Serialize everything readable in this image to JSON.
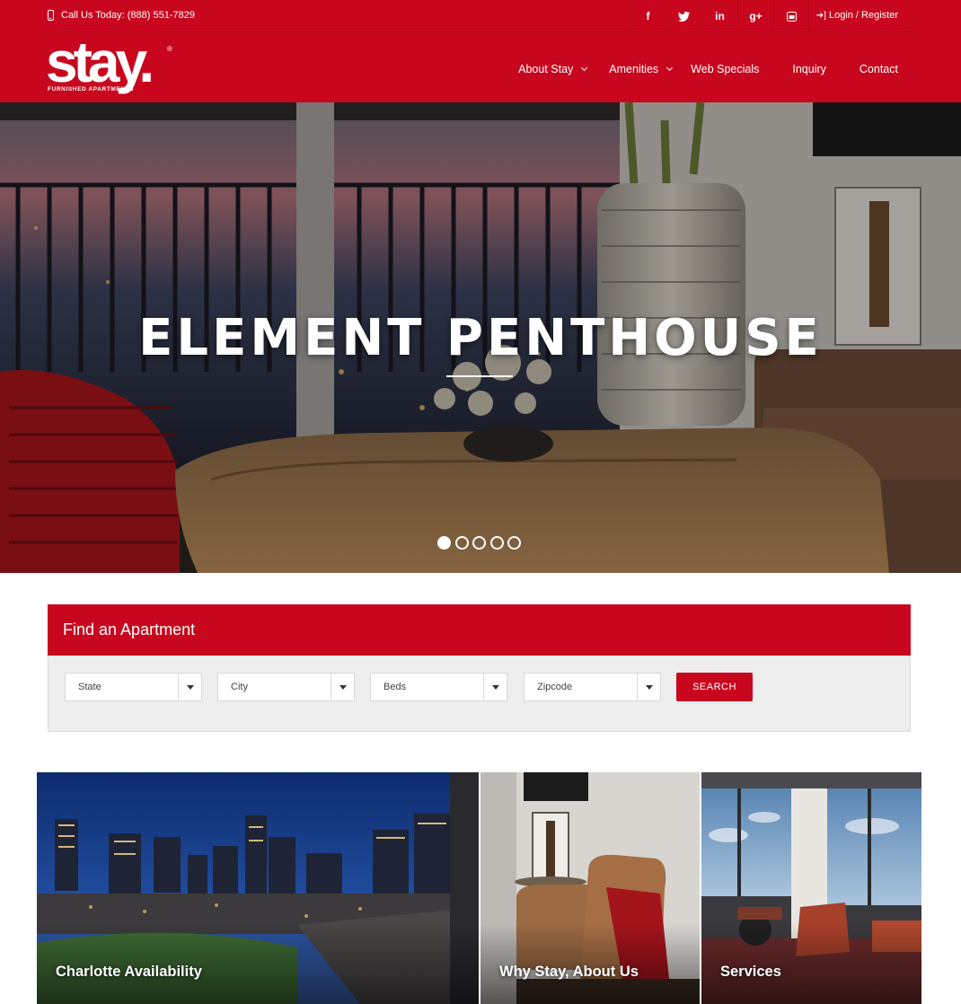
{
  "colors": {
    "brand": "#c8071e",
    "panel": "#eeeeee"
  },
  "header": {
    "phone": "Call Us Today: (888) 551-7829",
    "login": "Login / Register",
    "socials": [
      {
        "icon": "facebook-icon",
        "glyph": "f"
      },
      {
        "icon": "twitter-icon",
        "glyph": "t"
      },
      {
        "icon": "linkedin-icon",
        "glyph": "in"
      },
      {
        "icon": "google-plus-icon",
        "glyph": "g+"
      },
      {
        "icon": "youtube-icon",
        "glyph": "▣"
      }
    ],
    "logo": {
      "word": "stay.",
      "reg": "®",
      "tagline": "FURNISHED APARTMENTS"
    },
    "nav": [
      {
        "label": "About Stay",
        "dropdown": true
      },
      {
        "label": "Amenities",
        "dropdown": true
      },
      {
        "label": "Web Specials",
        "dropdown": false
      },
      {
        "label": "Inquiry",
        "dropdown": false
      },
      {
        "label": "Contact",
        "dropdown": false
      }
    ]
  },
  "hero": {
    "title": "ELEMENT PENTHOUSE",
    "slides": 5,
    "active_slide": 1
  },
  "finder": {
    "title": "Find an Apartment",
    "selects": [
      "State",
      "City",
      "Beds",
      "Zipcode"
    ],
    "search_label": "SEARCH"
  },
  "tiles": [
    {
      "label": "Charlotte Availability"
    },
    {
      "label": "Why Stay, About Us"
    },
    {
      "label": "Services"
    }
  ]
}
